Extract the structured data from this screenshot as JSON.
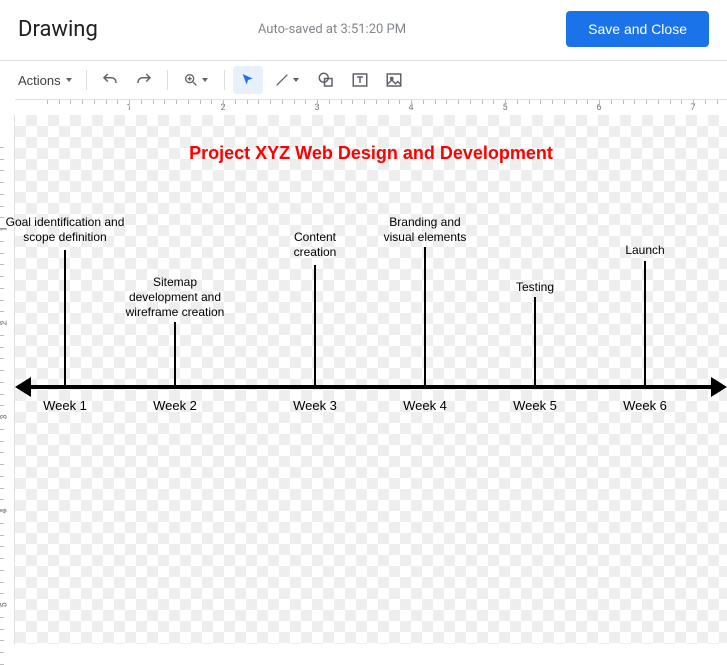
{
  "header": {
    "title": "Drawing",
    "autosave": "Auto-saved at 3:51:20 PM",
    "save_button": "Save and Close"
  },
  "toolbar": {
    "actions_label": "Actions"
  },
  "ruler": {
    "h_numbers": [
      "1",
      "2",
      "3",
      "4",
      "5",
      "6",
      "7"
    ],
    "v_numbers": [
      "1",
      "2",
      "3",
      "4",
      "5"
    ]
  },
  "diagram": {
    "title": "Project XYZ Web Design and Development",
    "milestones": [
      {
        "week": "Week 1",
        "desc": "Goal identification and\nscope definition"
      },
      {
        "week": "Week 2",
        "desc": "Sitemap\ndevelopment and\nwireframe creation"
      },
      {
        "week": "Week 3",
        "desc": "Content\ncreation"
      },
      {
        "week": "Week 4",
        "desc": "Branding and\nvisual elements"
      },
      {
        "week": "Week 5",
        "desc": "Testing"
      },
      {
        "week": "Week 6",
        "desc": "Launch"
      }
    ]
  }
}
